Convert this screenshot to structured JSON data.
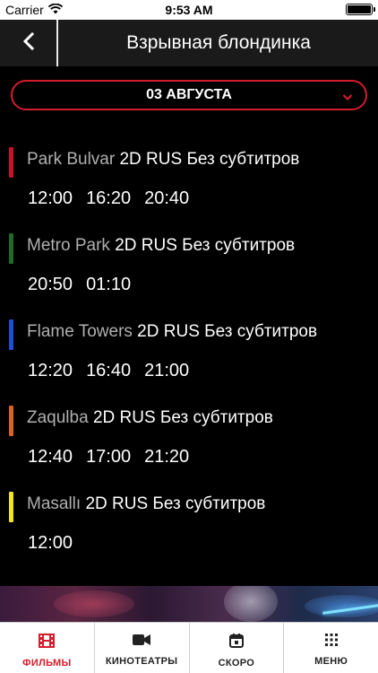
{
  "status_bar": {
    "carrier": "Carrier",
    "time": "9:53 AM",
    "battery_level": 1.0
  },
  "nav": {
    "title": "Взрывная блондинка",
    "back_icon": "chevron-left-icon"
  },
  "date_select": {
    "value": "03 АВГУСТА",
    "icon": "chevron-down-icon",
    "accent": "#d41c2c"
  },
  "cinemas": [
    {
      "name": "Park Bulvar",
      "format": " 2D RUS Без субтитров",
      "color": "#c8102e",
      "times": [
        "12:00",
        "16:20",
        "20:40"
      ]
    },
    {
      "name": "Metro Park",
      "format": " 2D RUS Без субтитров",
      "color": "#1e6b2a",
      "times": [
        "20:50",
        "01:10"
      ]
    },
    {
      "name": "Flame Towers",
      "format": " 2D RUS Без субтитров",
      "color": "#1f4fd6",
      "times": [
        "12:20",
        "16:40",
        "21:00"
      ]
    },
    {
      "name": "Zaqulba",
      "format": " 2D RUS Без субтитров",
      "color": "#d8641e",
      "times": [
        "12:40",
        "17:00",
        "21:20"
      ]
    },
    {
      "name": "Masallı",
      "format": " 2D RUS Без субтитров",
      "color": "#f2e51a",
      "times": [
        "12:00"
      ]
    }
  ],
  "tabs": [
    {
      "label": "ФИЛЬМЫ",
      "icon": "film-icon",
      "active": true
    },
    {
      "label": "КИНОТЕАТРЫ",
      "icon": "video-camera-icon",
      "active": false
    },
    {
      "label": "СКОРО",
      "icon": "calendar-icon",
      "active": false
    },
    {
      "label": "МЕНЮ",
      "icon": "grid-menu-icon",
      "active": false
    }
  ],
  "colors": {
    "accent": "#d41c2c",
    "background": "#000000",
    "nav_background": "#1a1a1a"
  }
}
